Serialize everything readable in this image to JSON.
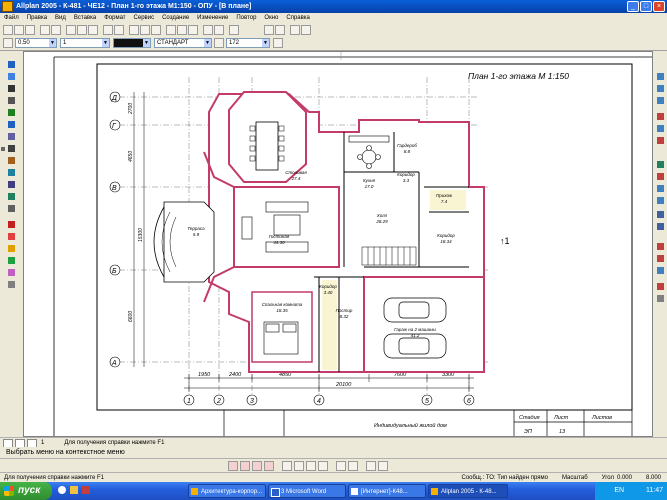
{
  "window": {
    "title": "Allplan 2005 - К-481 - ЧЕ12 - План 1-го этажа М1:150 - ОПУ - [В плане]",
    "min": "_",
    "max": "□",
    "close": "×"
  },
  "menu": [
    "Файл",
    "Правка",
    "Вид",
    "Вставка",
    "Формат",
    "Сервис",
    "Создание",
    "Изменение",
    "Повтор",
    "Окно",
    "Справка"
  ],
  "toolbar": {
    "pen": "0.50",
    "color_label": "1",
    "layer": "СТАНДАРТ",
    "scale": "172"
  },
  "drawing": {
    "title": "План 1-го этажа  М 1:150",
    "axes_rows": [
      "Д",
      "Г",
      "В",
      "Б",
      "А"
    ],
    "axes_cols": [
      "1",
      "2",
      "3",
      "4",
      "5",
      "6"
    ],
    "dims_bottom": [
      "1950",
      "2400",
      "4850",
      "7600",
      "3300"
    ],
    "dim_total": "20100",
    "dims_left": [
      "2700",
      "4650",
      "15300",
      "6600"
    ],
    "rooms": [
      {
        "name": "Столовая",
        "area": "27.4"
      },
      {
        "name": "Кухня",
        "area": "17.0"
      },
      {
        "name": "Гардероб",
        "area": "8.8"
      },
      {
        "name": "Коридор",
        "area": "3.3"
      },
      {
        "name": "Гостиная",
        "area": "44.30"
      },
      {
        "name": "Холл",
        "area": "28.29"
      },
      {
        "name": "Прихож",
        "area": "7.4"
      },
      {
        "name": "Коридор",
        "area": "18.34"
      },
      {
        "name": "Терраса",
        "area": "5.9"
      },
      {
        "name": "Коридор",
        "area": "3.40"
      },
      {
        "name": "Спальная комната",
        "area": "18.35"
      },
      {
        "name": "Постир",
        "area": "8.32"
      },
      {
        "name": "Гараж на 2 машины",
        "area": "41.2"
      }
    ],
    "stamp": {
      "project": "Индивидуальный жилой дом",
      "h_stage": "Стадия",
      "h_sheet": "Лист",
      "h_sheets": "Листов",
      "stage": "ЭП",
      "sheet": "13",
      "sheets": ""
    }
  },
  "status": {
    "tabs_icon_text": "1",
    "hint": "Для получения справки нажмите F1",
    "prompt": "Выбрать меню на контекстное меню",
    "messages": "Сообщ.: ТО: Тип найден прямо",
    "scale": "Масштаб",
    "coord_label": "Угол",
    "coord": "0.000",
    "zoom": "8.000"
  },
  "taskbar": {
    "start": "пуск",
    "tasks": [
      "Архитектура-корпор...",
      "3 Microsoft Word",
      "[Интернет]-К48...",
      "Allplan 2005 - К-48..."
    ],
    "lang": "EN",
    "time": "11:47"
  }
}
